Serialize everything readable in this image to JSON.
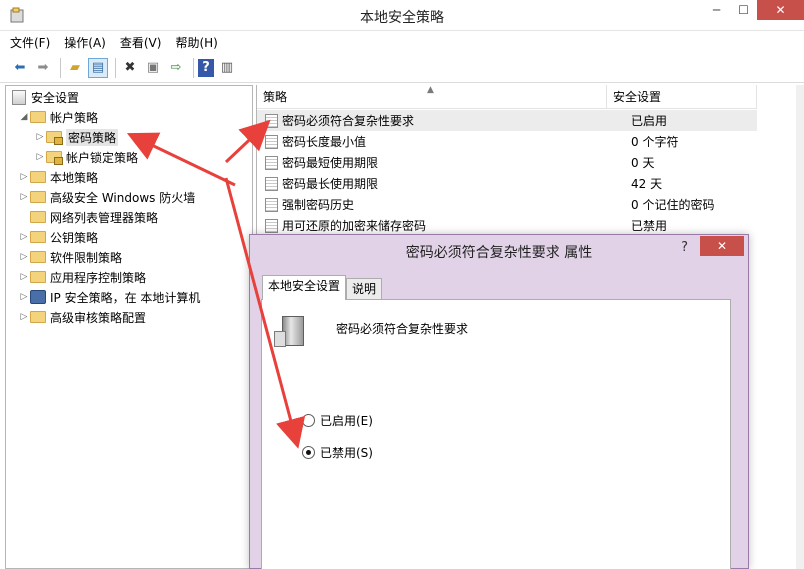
{
  "window": {
    "title": "本地安全策略"
  },
  "menu": [
    "文件(F)",
    "操作(A)",
    "查看(V)",
    "帮助(H)"
  ],
  "toolbar": {
    "buttons": [
      {
        "icon": "back-arrow-icon",
        "glyph": "⬅"
      },
      {
        "icon": "forward-arrow-icon",
        "glyph": "➡"
      },
      {
        "icon": "up-folder-icon",
        "glyph": "📂"
      },
      {
        "icon": "show-tree-icon",
        "glyph": "▤"
      },
      {
        "icon": "delete-icon",
        "glyph": "✖"
      },
      {
        "icon": "properties-icon",
        "glyph": "▣"
      },
      {
        "icon": "export-list-icon",
        "glyph": "⇨"
      },
      {
        "icon": "help-icon",
        "glyph": "?"
      },
      {
        "icon": "show-action-pane-icon",
        "glyph": "▥"
      }
    ]
  },
  "tree": {
    "root": "安全设置",
    "items": [
      {
        "label": "帐户策略",
        "exp": "◢",
        "indent": 1
      },
      {
        "label": "密码策略",
        "exp": "▷",
        "indent": 2,
        "selected": true
      },
      {
        "label": "帐户锁定策略",
        "exp": "▷",
        "indent": 2
      },
      {
        "label": "本地策略",
        "exp": "▷",
        "indent": 1
      },
      {
        "label": "高级安全 Windows 防火墙",
        "exp": "▷",
        "indent": 1
      },
      {
        "label": "网络列表管理器策略",
        "exp": "",
        "indent": 1
      },
      {
        "label": "公钥策略",
        "exp": "▷",
        "indent": 1
      },
      {
        "label": "软件限制策略",
        "exp": "▷",
        "indent": 1
      },
      {
        "label": "应用程序控制策略",
        "exp": "▷",
        "indent": 1
      },
      {
        "label": "IP 安全策略，在 本地计算机",
        "exp": "▷",
        "indent": 1
      },
      {
        "label": "高级审核策略配置",
        "exp": "▷",
        "indent": 1
      }
    ]
  },
  "list": {
    "col_policy": "策略",
    "col_setting": "安全设置",
    "rows": [
      {
        "name": "密码必须符合复杂性要求",
        "value": "已启用"
      },
      {
        "name": "密码长度最小值",
        "value": "0 个字符"
      },
      {
        "name": "密码最短使用期限",
        "value": "0 天"
      },
      {
        "name": "密码最长使用期限",
        "value": "42 天"
      },
      {
        "name": "强制密码历史",
        "value": "0 个记住的密码"
      },
      {
        "name": "用可还原的加密来储存密码",
        "value": "已禁用"
      }
    ]
  },
  "dialog": {
    "title": "密码必须符合复杂性要求 属性",
    "help": "?",
    "tab_local": "本地安全设置",
    "tab_explain": "说明",
    "policy_name": "密码必须符合复杂性要求",
    "radio_enabled": "已启用(E)",
    "radio_disabled": "已禁用(S)",
    "selected": "disabled"
  },
  "colors": {
    "arrow": "#e8403a",
    "close": "#c7504a",
    "dialog_frame": "#e1d2e8"
  }
}
